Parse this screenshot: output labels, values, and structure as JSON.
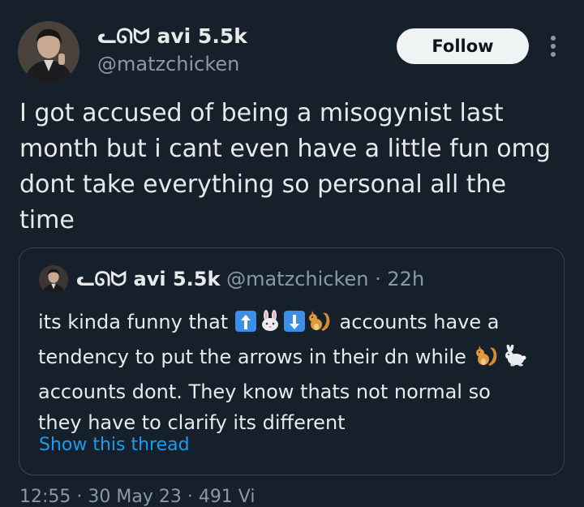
{
  "author": {
    "display_name": "ᓚᘏᗢ avi 5.5k",
    "handle": "@matzchicken"
  },
  "actions": {
    "follow_label": "Follow",
    "more_icon": "more-vertical-icon"
  },
  "tweet": {
    "lines": [
      "I got accused of being a misogynist last",
      "month but i cant even have a little fun omg",
      "dont take everything so personal all the",
      "time"
    ]
  },
  "quote": {
    "display_name": "ᓚᘏᗢ avi 5.5k",
    "handle": "@matzchicken",
    "separator": "·",
    "time": "22h",
    "line1_pre": "its kinda funny that",
    "line1_post": "accounts have a",
    "line2_pre": "tendency to put the arrows in their dn while",
    "line3": "accounts dont. They know thats not normal so",
    "line4": "they have to clarify its different",
    "emojis": [
      "up-arrow-emoji",
      "rabbit-face-emoji",
      "down-arrow-emoji",
      "squirrel-emoji",
      "squirrel-emoji",
      "rabbit-emoji"
    ],
    "show_thread": "Show this thread"
  },
  "footer": {
    "partial_text": "12:55 · 30 May 23 · 491 Vi"
  }
}
